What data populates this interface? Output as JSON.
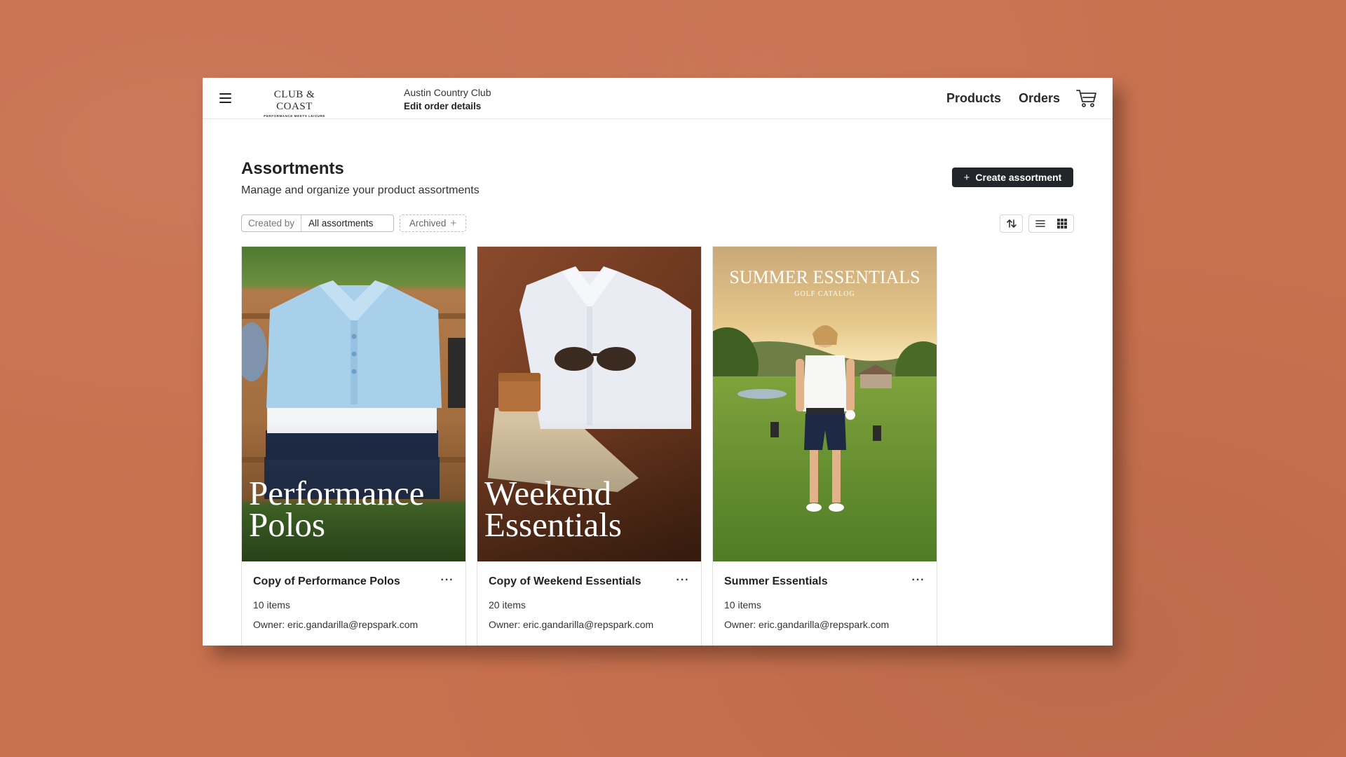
{
  "header": {
    "logo_main": "CLUB & COAST",
    "logo_sub": "PERFORMANCE MEETS LEISURE",
    "club_name": "Austin Country Club",
    "club_action": "Edit order details",
    "nav": [
      {
        "label": "Products"
      },
      {
        "label": "Orders"
      }
    ],
    "icons": [
      "hamburger-menu-icon",
      "cart-icon"
    ]
  },
  "page": {
    "title": "Assortments",
    "subtitle": "Manage and organize your product assortments",
    "create_button": "Create assortment"
  },
  "filters": {
    "created_by_label": "Created by",
    "created_by_value": "All assortments",
    "archived_label": "Archived"
  },
  "toolbar": {
    "icons": [
      "sort-icon",
      "list-view-icon",
      "grid-view-icon"
    ],
    "active_view": "grid"
  },
  "cards": [
    {
      "title": "Copy of Performance Polos",
      "count": "10 items",
      "owner": "Owner: eric.gandarilla@repspark.com",
      "cover_line1": "Performance",
      "cover_line2": "Polos"
    },
    {
      "title": "Copy of Weekend Essentials",
      "count": "20 items",
      "owner": "Owner: eric.gandarilla@repspark.com",
      "cover_line1": "Weekend",
      "cover_line2": "Essentials"
    },
    {
      "title": "Summer Essentials",
      "count": "10 items",
      "owner": "Owner: eric.gandarilla@repspark.com",
      "cover_line1": "SUMMER ESSENTIALS",
      "cover_line2": "GOLF CATALOG"
    }
  ],
  "colors": {
    "background": "#c8714f",
    "primary_button": "#222529",
    "text": "#222222"
  }
}
